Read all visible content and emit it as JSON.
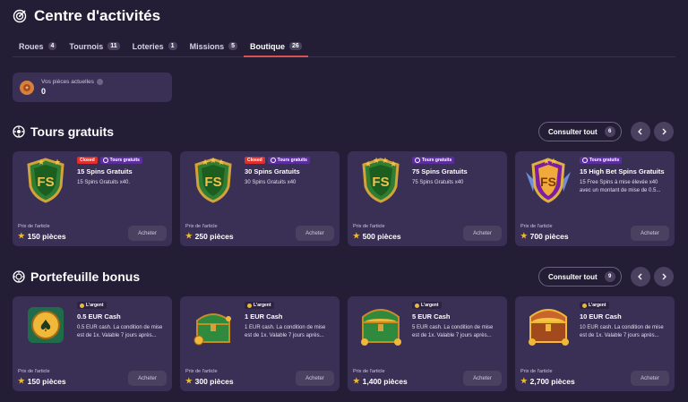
{
  "header": {
    "title": "Centre d'activités",
    "icon": "target-icon"
  },
  "tabs": [
    {
      "label": "Roues",
      "count": "4",
      "active": false
    },
    {
      "label": "Tournois",
      "count": "11",
      "active": false
    },
    {
      "label": "Loteries",
      "count": "1",
      "active": false
    },
    {
      "label": "Missions",
      "count": "5",
      "active": false
    },
    {
      "label": "Boutique",
      "count": "26",
      "active": true
    }
  ],
  "coins": {
    "label": "Vos pièces actuelles",
    "value": "0"
  },
  "free_spins": {
    "title": "Tours gratuits",
    "view_all": "Consulter tout",
    "count": "6",
    "cards": [
      {
        "badges": [
          "Closed",
          "Tours gratuits"
        ],
        "name": "15 Spins Gratuits",
        "desc": "15 Spins Gratuits x40.",
        "price_label": "Prix de l'article",
        "price": "150 pièces",
        "buy": "Acheter",
        "thumb": "FS"
      },
      {
        "badges": [
          "Closed",
          "Tours gratuits"
        ],
        "name": "30 Spins Gratuits",
        "desc": "30 Spins Gratuits x40",
        "price_label": "Prix de l'article",
        "price": "250 pièces",
        "buy": "Acheter",
        "thumb": "FS"
      },
      {
        "badges": [
          "Tours gratuits"
        ],
        "name": "75 Spins Gratuits",
        "desc": "75 Spins Gratuits x40",
        "price_label": "Prix de l'article",
        "price": "500 pièces",
        "buy": "Acheter",
        "thumb": "FS"
      },
      {
        "badges": [
          "Tours gratuits"
        ],
        "name": "15 High Bet Spins Gratuits",
        "desc": "15 Free Spins à mise élevée x40 avec un montant de mise de 0.5...",
        "price_label": "Prix de l'article",
        "price": "700 pièces",
        "buy": "Acheter",
        "thumb": "FS"
      }
    ]
  },
  "bonus_wallet": {
    "title": "Portefeuille bonus",
    "view_all": "Consulter tout",
    "count": "9",
    "cards": [
      {
        "badges": [
          "L'argent"
        ],
        "name": "0.5 EUR Cash",
        "desc": "0.5 EUR cash. La condition de mise est de 1x. Valable 7 jours après...",
        "price_label": "Prix de l'article",
        "price": "150 pièces",
        "buy": "Acheter",
        "thumb": "spade"
      },
      {
        "badges": [
          "L'argent"
        ],
        "name": "1 EUR Cash",
        "desc": "1 EUR cash. La condition de mise est de 1x. Valable 7 jours après...",
        "price_label": "Prix de l'article",
        "price": "300 pièces",
        "buy": "Acheter",
        "thumb": "chest-green"
      },
      {
        "badges": [
          "L'argent"
        ],
        "name": "5 EUR Cash",
        "desc": "5 EUR cash. La condition de mise est de 1x. Valable 7 jours après...",
        "price_label": "Prix de l'article",
        "price": "1,400 pièces",
        "buy": "Acheter",
        "thumb": "chest-green"
      },
      {
        "badges": [
          "L'argent"
        ],
        "name": "10 EUR Cash",
        "desc": "10 EUR cash. La condition de mise est de 1x. Valable 7 jours après...",
        "price_label": "Prix de l'article",
        "price": "2,700 pièces",
        "buy": "Acheter",
        "thumb": "chest-gold"
      }
    ]
  },
  "colors": {
    "background": "#231d35",
    "card": "#3a2f55",
    "accent": "#d65252",
    "closed": "#e0302d",
    "tours": "#5c2d9e",
    "coin": "#e8b93a"
  }
}
